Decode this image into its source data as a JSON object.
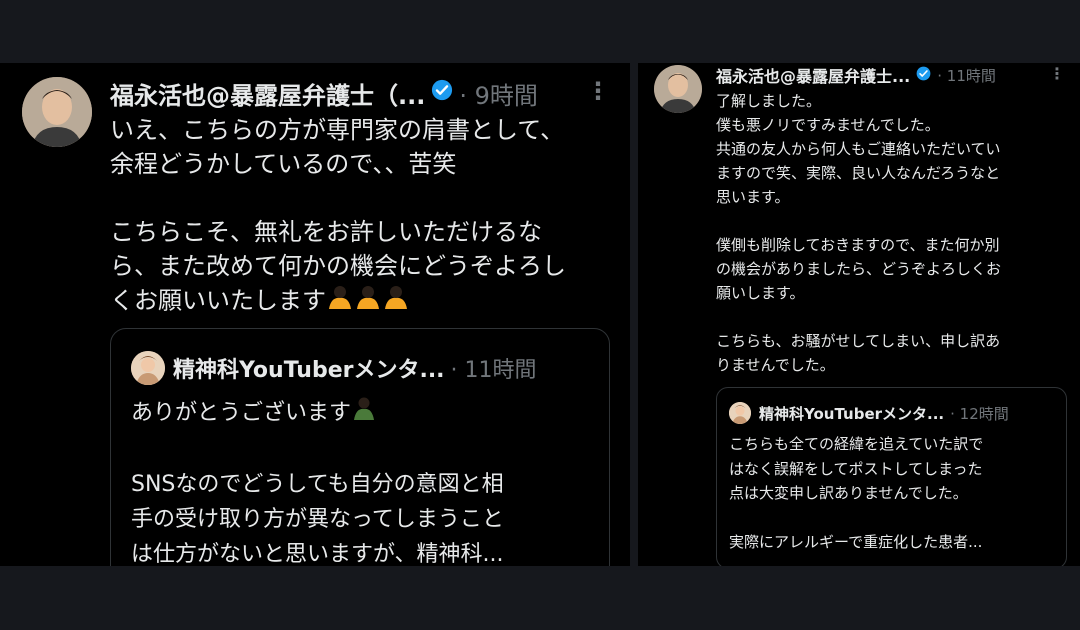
{
  "left": {
    "author": "福永活也@暴露屋弁護士（...",
    "time": "· 9時間",
    "more": "⋮",
    "body": "いえ、こちらの方が専門家の肩書として、\n余程どうかしているので、、苦笑\n\nこちらこそ、無礼をお許しいただけるな\nら、また改めて何かの機会にどうぞよろし\nくお願いいたします",
    "trailing_emoji": [
      "bowing-person-emoji",
      "bowing-person-emoji",
      "bowing-person-emoji"
    ],
    "quote": {
      "author": "精神科YouTuberメンタ...",
      "time": "· 11時間",
      "body_line1": "ありがとうございます",
      "body_rest": "SNSなのでどうしても自分の意図と相\n手の受け取り方が異なってしまうこと\nは仕方がないと思いますが、精神科..."
    }
  },
  "right": {
    "author": "福永活也@暴露屋弁護士...",
    "time": "· 11時間",
    "more": "⋮",
    "body": "了解しました。\n僕も悪ノリですみませんでした。\n共通の友人から何人もご連絡いただいてい\nますので笑、実際、良い人なんだろうなと\n思います。\n\n僕側も削除しておきますので、また何か別\nの機会がありましたら、どうぞよろしくお\n願いします。\n\nこちらも、お騒がせしてしまい、申し訳あ\nりませんでした。",
    "quote": {
      "author": "精神科YouTuberメンタ...",
      "time": "· 12時間",
      "body": "こちらも全ての経緯を追えていた訳で\nはなく誤解をしてポストしてしまった\n点は大変申し訳ありませんでした。\n\n実際にアレルギーで重症化した患者..."
    }
  },
  "colors": {
    "verified": "#1d9bf0",
    "muted": "#71767b",
    "border": "#2f3336",
    "background": "#000000",
    "text": "#e7e9ea"
  }
}
